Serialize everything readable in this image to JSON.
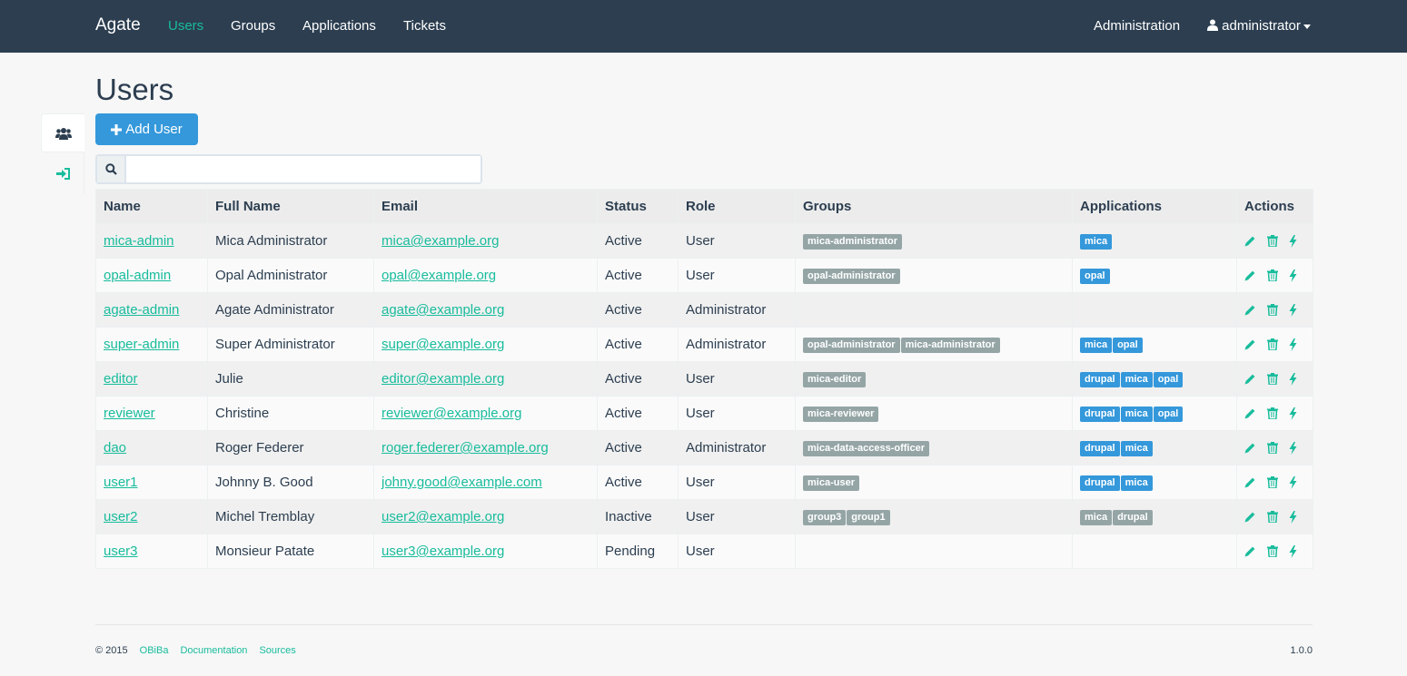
{
  "nav": {
    "brand": "Agate",
    "links": [
      "Users",
      "Groups",
      "Applications",
      "Tickets"
    ],
    "administration": "Administration",
    "user": "administrator"
  },
  "page": {
    "title": "Users",
    "add_button": "Add User",
    "search_placeholder": ""
  },
  "table": {
    "headers": [
      "Name",
      "Full Name",
      "Email",
      "Status",
      "Role",
      "Groups",
      "Applications",
      "Actions"
    ],
    "rows": [
      {
        "name": "mica-admin",
        "full_name": "Mica Administrator",
        "email": "mica@example.org",
        "status": "Active",
        "role": "User",
        "groups": [
          "mica-administrator"
        ],
        "applications": [
          "mica"
        ]
      },
      {
        "name": "opal-admin",
        "full_name": "Opal Administrator",
        "email": "opal@example.org",
        "status": "Active",
        "role": "User",
        "groups": [
          "opal-administrator"
        ],
        "applications": [
          "opal"
        ]
      },
      {
        "name": "agate-admin",
        "full_name": "Agate Administrator",
        "email": "agate@example.org",
        "status": "Active",
        "role": "Administrator",
        "groups": [],
        "applications": []
      },
      {
        "name": "super-admin",
        "full_name": "Super Administrator",
        "email": "super@example.org",
        "status": "Active",
        "role": "Administrator",
        "groups": [
          "opal-administrator",
          "mica-administrator"
        ],
        "applications": [
          "mica",
          "opal"
        ]
      },
      {
        "name": "editor",
        "full_name": "Julie",
        "email": "editor@example.org",
        "status": "Active",
        "role": "User",
        "groups": [
          "mica-editor"
        ],
        "applications": [
          "drupal",
          "mica",
          "opal"
        ]
      },
      {
        "name": "reviewer",
        "full_name": "Christine",
        "email": "reviewer@example.org",
        "status": "Active",
        "role": "User",
        "groups": [
          "mica-reviewer"
        ],
        "applications": [
          "drupal",
          "mica",
          "opal"
        ]
      },
      {
        "name": "dao",
        "full_name": "Roger Federer",
        "email": "roger.federer@example.org",
        "status": "Active",
        "role": "Administrator",
        "groups": [
          "mica-data-access-officer"
        ],
        "applications": [
          "drupal",
          "mica"
        ]
      },
      {
        "name": "user1",
        "full_name": "Johnny B. Good",
        "email": "johny.good@example.com",
        "status": "Active",
        "role": "User",
        "groups": [
          "mica-user"
        ],
        "applications": [
          "drupal",
          "mica"
        ]
      },
      {
        "name": "user2",
        "full_name": "Michel Tremblay",
        "email": "user2@example.org",
        "status": "Inactive",
        "role": "User",
        "groups": [
          "group3",
          "group1"
        ],
        "applications": [
          "mica",
          "drupal"
        ],
        "applications_inactive": true
      },
      {
        "name": "user3",
        "full_name": "Monsieur Patate",
        "email": "user3@example.org",
        "status": "Pending",
        "role": "User",
        "groups": [],
        "applications": []
      }
    ]
  },
  "footer": {
    "copyright": "© 2015",
    "links": [
      "OBiBa",
      "Documentation",
      "Sources"
    ],
    "version": "1.0.0"
  },
  "colors": {
    "navbar": "#2c3e50",
    "accent": "#18bc9c",
    "primary": "#3498db",
    "badge_grey": "#95a5a6"
  },
  "icons": {
    "users_tab": "users-icon",
    "signin_tab": "sign-in-icon",
    "search": "search-icon",
    "add": "plus-icon",
    "edit": "pencil-icon",
    "delete": "trash-icon",
    "activate": "bolt-icon",
    "user_menu": "user-icon"
  }
}
